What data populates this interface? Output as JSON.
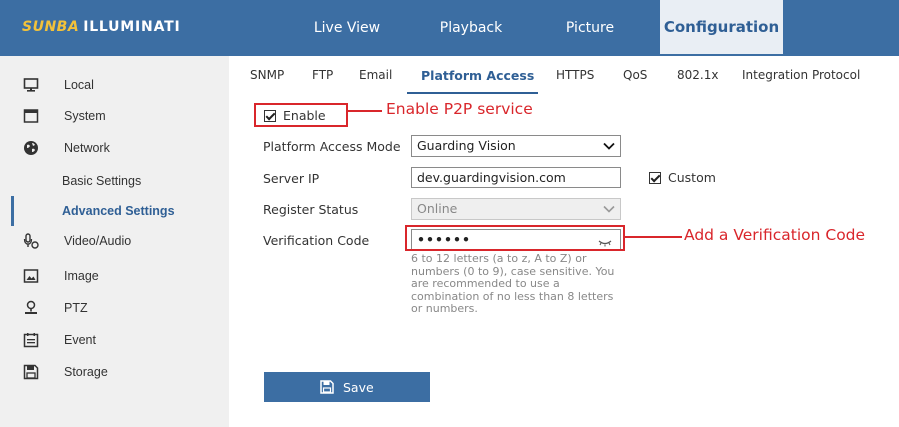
{
  "header": {
    "logo_brand": "SUNBA",
    "logo_name": "ILLUMINATI",
    "tabs": [
      {
        "label": "Live View"
      },
      {
        "label": "Playback"
      },
      {
        "label": "Picture"
      },
      {
        "label": "Configuration",
        "active": true
      }
    ]
  },
  "sidebar": {
    "items": [
      {
        "label": "Local",
        "icon": "monitor-icon"
      },
      {
        "label": "System",
        "icon": "window-icon"
      },
      {
        "label": "Network",
        "icon": "globe-icon"
      },
      {
        "label": "Basic Settings",
        "sub": true
      },
      {
        "label": "Advanced Settings",
        "sub": true,
        "active": true
      },
      {
        "label": "Video/Audio",
        "icon": "microphone-icon"
      },
      {
        "label": "Image",
        "icon": "image-icon"
      },
      {
        "label": "PTZ",
        "icon": "ptz-icon"
      },
      {
        "label": "Event",
        "icon": "calendar-icon"
      },
      {
        "label": "Storage",
        "icon": "save-disk-icon"
      }
    ]
  },
  "content_tabs": [
    {
      "label": "SNMP"
    },
    {
      "label": "FTP"
    },
    {
      "label": "Email"
    },
    {
      "label": "Platform Access",
      "active": true
    },
    {
      "label": "HTTPS"
    },
    {
      "label": "QoS"
    },
    {
      "label": "802.1x"
    },
    {
      "label": "Integration Protocol"
    }
  ],
  "form": {
    "enable_label": "Enable",
    "enable_checked": true,
    "mode_label": "Platform Access Mode",
    "mode_value": "Guarding Vision",
    "server_ip_label": "Server IP",
    "server_ip_value": "dev.guardingvision.com",
    "custom_label": "Custom",
    "custom_checked": true,
    "register_label": "Register Status",
    "register_value": "Online",
    "verification_label": "Verification Code",
    "verification_value": "••••••",
    "verification_hint": "6 to 12 letters (a to z, A to Z) or numbers (0 to 9), case sensitive. You are recommended to use a combination of no less than 8 letters or numbers.",
    "save_label": "Save"
  },
  "annotations": {
    "enable_note": "Enable P2P service",
    "verification_note": "Add a Verification Code"
  },
  "colors": {
    "header_bg": "#3c6ea3",
    "accent": "#2f5f95",
    "annotation_red": "#d9262b",
    "logo_yellow": "#f2c23a",
    "sidebar_bg": "#f0f0f0"
  }
}
